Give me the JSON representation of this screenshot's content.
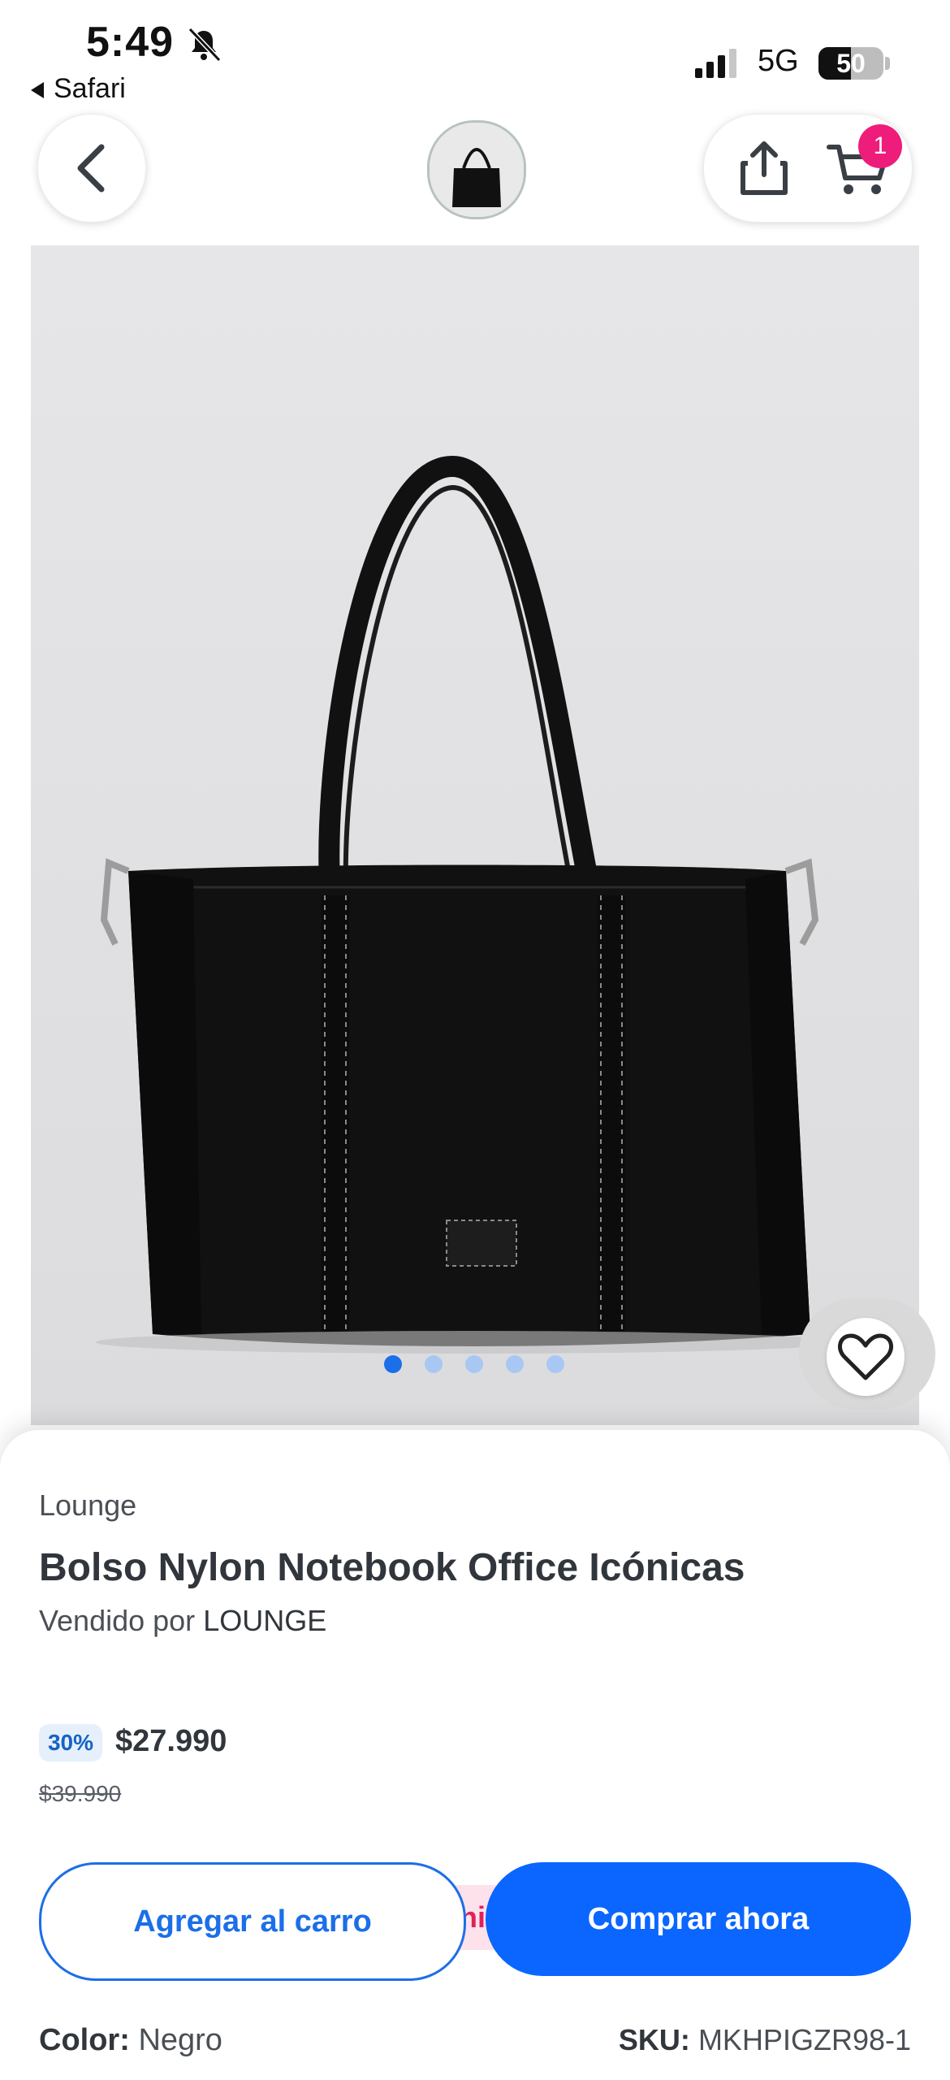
{
  "status_bar": {
    "time": "5:49",
    "back_app": "Safari",
    "network": "5G",
    "battery": "50",
    "battery_level": 0.5
  },
  "header": {
    "cart_count": "1",
    "icons": [
      "chevron-left-icon",
      "share-icon",
      "cart-icon"
    ]
  },
  "gallery": {
    "total_images": 5,
    "active_index": 0
  },
  "product": {
    "brand": "Lounge",
    "title": "Bolso Nylon Notebook Office Icónicas",
    "sold_by_prefix": "Vendido por",
    "sold_by_name": "LOUNGE",
    "discount": "30%",
    "price": "$27.990",
    "original_price": "$39.990",
    "hidden_tag_text": "ni",
    "color_label": "Color:",
    "color_value": "Negro",
    "sku_label": "SKU:",
    "sku_value": "MKHPIGZR98-1"
  },
  "actions": {
    "add_to_cart": "Agregar al carro",
    "buy_now": "Comprar ahora"
  },
  "colors": {
    "primary": "#0a66ff",
    "badge": "#ee1c7b",
    "discount_bg": "#e6f0fc"
  }
}
